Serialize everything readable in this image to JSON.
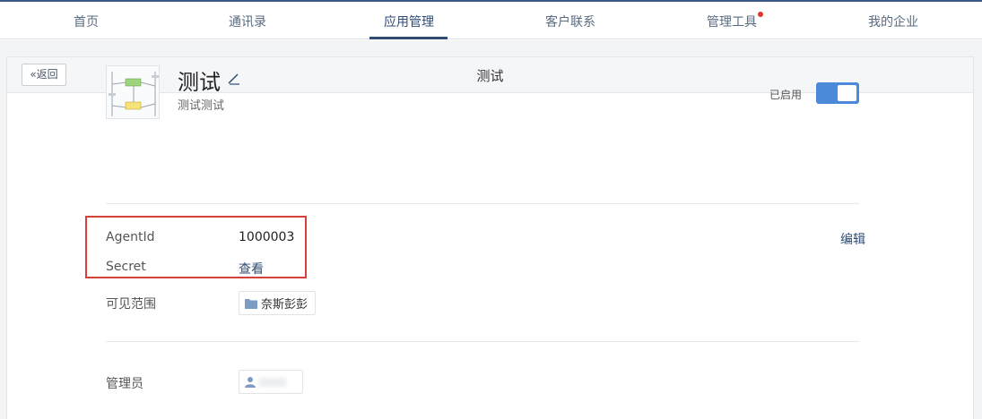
{
  "nav": {
    "items": [
      "首页",
      "通讯录",
      "应用管理",
      "客户联系",
      "管理工具",
      "我的企业"
    ],
    "active_index": 2,
    "notification_dot_on": "管理工具"
  },
  "header": {
    "back_label": "返回",
    "title": "测试"
  },
  "app": {
    "name": "测试",
    "description": "测试测试",
    "status_label": "已启用",
    "enabled": true,
    "logo_icon": "flowchart-thumbnail"
  },
  "credentials": {
    "agentid_label": "AgentId",
    "agentid_value": "1000003",
    "secret_label": "Secret",
    "secret_action": "查看",
    "edit_label": "编辑"
  },
  "visibility": {
    "label": "可见范围",
    "department": "奈斯彭彭"
  },
  "admin": {
    "label": "管理员"
  },
  "colors": {
    "brand": "#2f4d74",
    "toggle": "#4a8ad8",
    "highlight": "#d9403a",
    "notify": "#e5332a"
  }
}
